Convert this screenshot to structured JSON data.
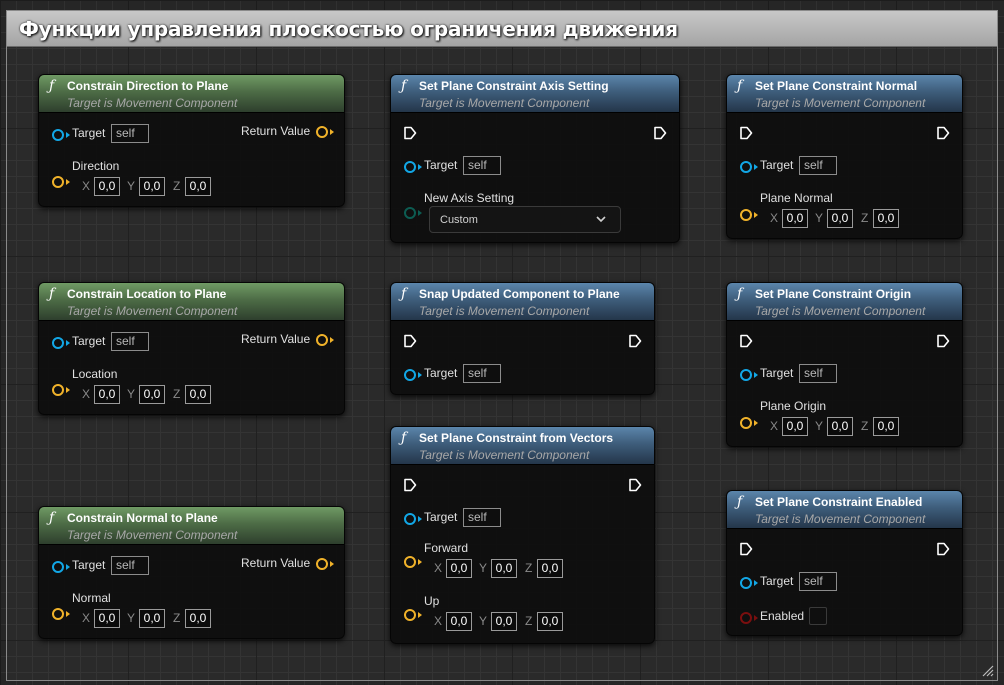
{
  "comment": {
    "title": "Функции управления плоскостью ограничения движения"
  },
  "nodes": {
    "n1": {
      "title": "Constrain Direction to Plane",
      "subtitle": "Target is Movement Component",
      "target": {
        "label": "Target",
        "value": "self"
      },
      "return_label": "Return Value",
      "vector": {
        "label": "Direction",
        "x": "0,0",
        "y": "0,0",
        "z": "0,0"
      }
    },
    "n2": {
      "title": "Set Plane Constraint Axis Setting",
      "subtitle": "Target is Movement Component",
      "target": {
        "label": "Target",
        "value": "self"
      },
      "enum": {
        "label": "New Axis Setting",
        "value": "Custom"
      }
    },
    "n3": {
      "title": "Set Plane Constraint Normal",
      "subtitle": "Target is Movement Component",
      "target": {
        "label": "Target",
        "value": "self"
      },
      "vector": {
        "label": "Plane Normal",
        "x": "0,0",
        "y": "0,0",
        "z": "0,0"
      }
    },
    "n4": {
      "title": "Constrain Location to Plane",
      "subtitle": "Target is Movement Component",
      "target": {
        "label": "Target",
        "value": "self"
      },
      "return_label": "Return Value",
      "vector": {
        "label": "Location",
        "x": "0,0",
        "y": "0,0",
        "z": "0,0"
      }
    },
    "n5": {
      "title": "Snap Updated Component to Plane",
      "subtitle": "Target is Movement Component",
      "target": {
        "label": "Target",
        "value": "self"
      }
    },
    "n6": {
      "title": "Set Plane Constraint Origin",
      "subtitle": "Target is Movement Component",
      "target": {
        "label": "Target",
        "value": "self"
      },
      "vector": {
        "label": "Plane Origin",
        "x": "0,0",
        "y": "0,0",
        "z": "0,0"
      }
    },
    "n7": {
      "title": "Set Plane Constraint from Vectors",
      "subtitle": "Target is Movement Component",
      "target": {
        "label": "Target",
        "value": "self"
      },
      "forward": {
        "label": "Forward",
        "x": "0,0",
        "y": "0,0",
        "z": "0,0"
      },
      "up": {
        "label": "Up",
        "x": "0,0",
        "y": "0,0",
        "z": "0,0"
      }
    },
    "n8": {
      "title": "Constrain Normal to Plane",
      "subtitle": "Target is Movement Component",
      "target": {
        "label": "Target",
        "value": "self"
      },
      "return_label": "Return Value",
      "vector": {
        "label": "Normal",
        "x": "0,0",
        "y": "0,0",
        "z": "0,0"
      }
    },
    "n9": {
      "title": "Set Plane Constraint Enabled",
      "subtitle": "Target is Movement Component",
      "target": {
        "label": "Target",
        "value": "self"
      },
      "bool": {
        "label": "Enabled"
      }
    }
  },
  "axes": {
    "x": "X",
    "y": "Y",
    "z": "Z"
  },
  "colors": {
    "pure_header": "#587f50",
    "impure_header": "#4a6e90",
    "object_pin": "#12a7e6",
    "vector_pin": "#f0b22a",
    "enum_pin": "#0c5c52",
    "bool_pin": "#7a0f0f"
  }
}
